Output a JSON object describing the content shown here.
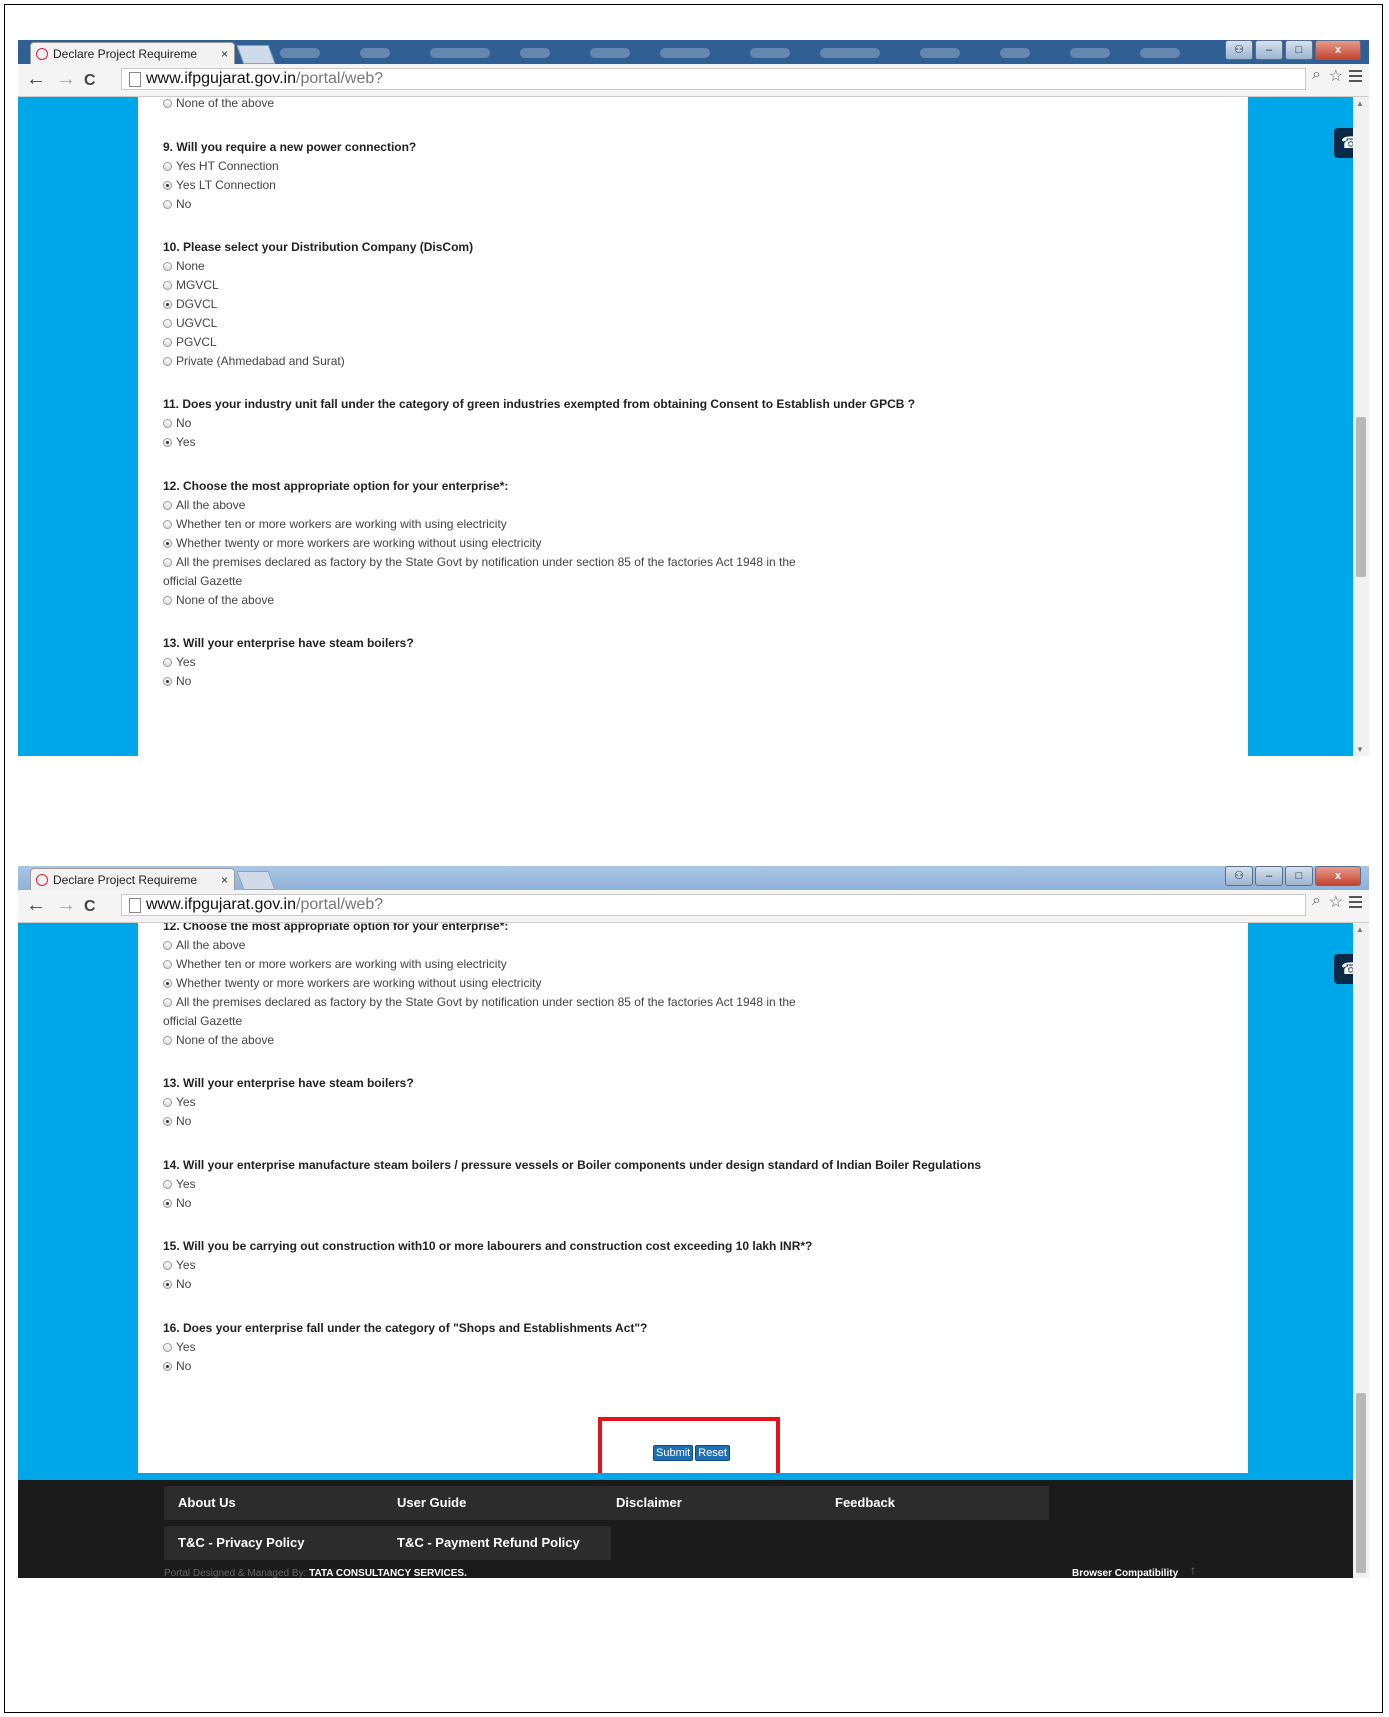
{
  "browser": {
    "tab_title": "Declare Project Requireme",
    "tab_close": "×",
    "url_host": "www.ifpgujarat.gov.in",
    "url_path": "/portal/web?",
    "back": "←",
    "forward": "→",
    "reload": "C"
  },
  "shot1": {
    "top_option": "None of the above",
    "q9": {
      "question": "9. Will you require a new power connection?",
      "options": [
        "Yes HT Connection",
        "Yes LT Connection",
        "No"
      ],
      "selected": 1
    },
    "q10": {
      "question": "10. Please select your Distribution Company (DisCom)",
      "options": [
        "None",
        "MGVCL",
        "DGVCL",
        "UGVCL",
        "PGVCL",
        "Private (Ahmedabad and Surat)"
      ],
      "selected": 2
    },
    "q11": {
      "question": "11. Does your industry unit fall under the category of green industries exempted from obtaining Consent to Establish under GPCB ?",
      "options": [
        "No",
        "Yes"
      ],
      "selected": 1
    },
    "q12": {
      "question": "12. Choose the most appropriate option for your enterprise*:",
      "options": [
        "All the above",
        "Whether ten or more workers are working with using electricity",
        "Whether twenty or more workers are working without using electricity",
        "All the premises declared as factory by the State Govt by notification under section 85 of the factories Act 1948 in the",
        "None of the above"
      ],
      "continuation": "official Gazette",
      "selected": 2
    },
    "q13": {
      "question": "13. Will your enterprise have steam boilers?",
      "options": [
        "Yes",
        "No"
      ],
      "selected": 1
    }
  },
  "shot2": {
    "q12": {
      "question": "12. Choose the most appropriate option for your enterprise*:",
      "options": [
        "All the above",
        "Whether ten or more workers are working with using electricity",
        "Whether twenty or more workers are working without using electricity",
        "All the premises declared as factory by the State Govt by notification under section 85 of the factories Act 1948 in the",
        "None of the above"
      ],
      "continuation": "official Gazette",
      "selected": 2
    },
    "q13": {
      "question": "13. Will your enterprise have steam boilers?",
      "options": [
        "Yes",
        "No"
      ],
      "selected": 1
    },
    "q14": {
      "question": "14. Will your enterprise manufacture steam boilers / pressure vessels or Boiler components under design standard of Indian Boiler Regulations",
      "options": [
        "Yes",
        "No"
      ],
      "selected": 1
    },
    "q15": {
      "question": "15. Will you be carrying out construction with10 or more labourers and construction cost exceeding 10 lakh INR*?",
      "options": [
        "Yes",
        "No"
      ],
      "selected": 1
    },
    "q16": {
      "question": "16. Does your enterprise fall under the category of \"Shops and Establishments Act\"?",
      "options": [
        "Yes",
        "No"
      ],
      "selected": 1
    },
    "submit_label": "Submit",
    "reset_label": "Reset"
  },
  "footer": {
    "links": [
      "About Us",
      "User Guide",
      "Disclaimer",
      "Feedback",
      "T&C - Privacy Policy",
      "T&C - Payment Refund Policy"
    ],
    "designed_by": "Portal Designed & Managed By:",
    "company": "TATA CONSULTANCY SERVICES.",
    "compat": "Browser Compatibility",
    "up_arrow": "↑"
  },
  "colors": {
    "page_bg": "#00a7e8",
    "footer_bg": "#1b1b1b",
    "highlight": "#e0141a",
    "button": "#1f6fb5"
  }
}
